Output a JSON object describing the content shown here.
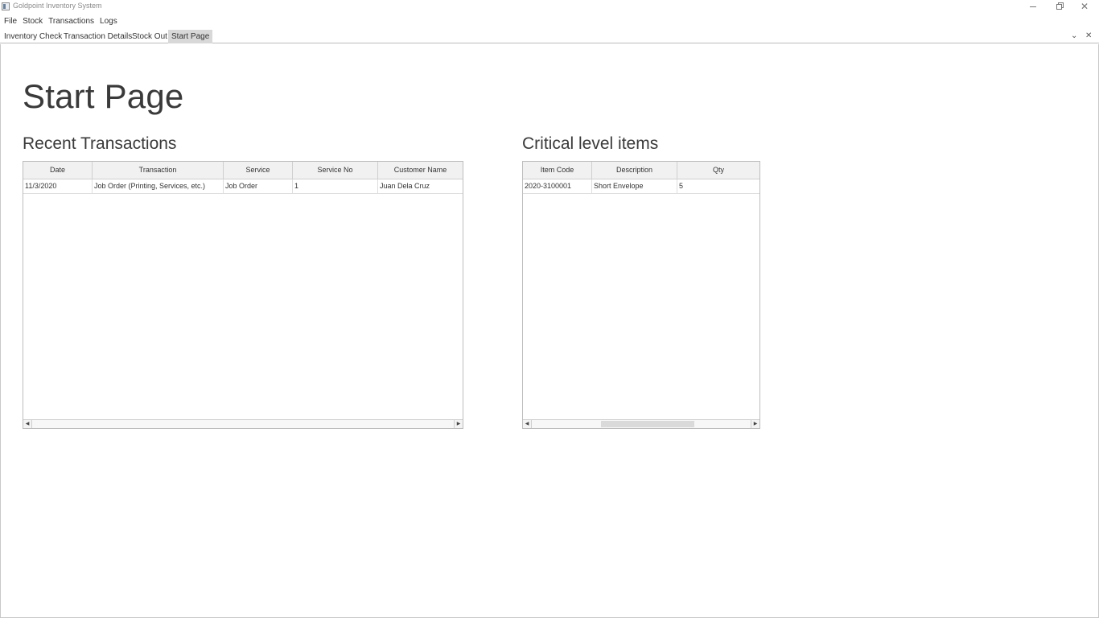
{
  "window": {
    "title": "Goldpoint Inventory System"
  },
  "menu": [
    "File",
    "Stock",
    "Transactions",
    "Logs"
  ],
  "tabs": [
    {
      "label": "Inventory Check",
      "active": false
    },
    {
      "label": "Transaction Details",
      "active": false
    },
    {
      "label": "Stock Out",
      "active": false
    },
    {
      "label": "Start Page",
      "active": true
    }
  ],
  "page": {
    "title": "Start Page",
    "recent": {
      "title": "Recent Transactions",
      "columns": [
        "Date",
        "Transaction",
        "Service",
        "Service No",
        "Customer Name"
      ],
      "rows": [
        [
          "11/3/2020",
          "Job Order (Printing, Services, etc.)",
          "Job Order",
          "1",
          "Juan Dela Cruz"
        ]
      ]
    },
    "critical": {
      "title": "Critical level items",
      "columns": [
        "Item Code",
        "Description",
        "Qty"
      ],
      "rows": [
        [
          "2020-3100001",
          "Short Envelope",
          "5"
        ]
      ],
      "scroll_position": 0.55
    }
  },
  "icons": {
    "minimize": "minimize-icon",
    "maximize": "restore-icon",
    "close": "close-icon",
    "tab_list": "chevron-down-icon",
    "tab_close": "close-icon"
  }
}
